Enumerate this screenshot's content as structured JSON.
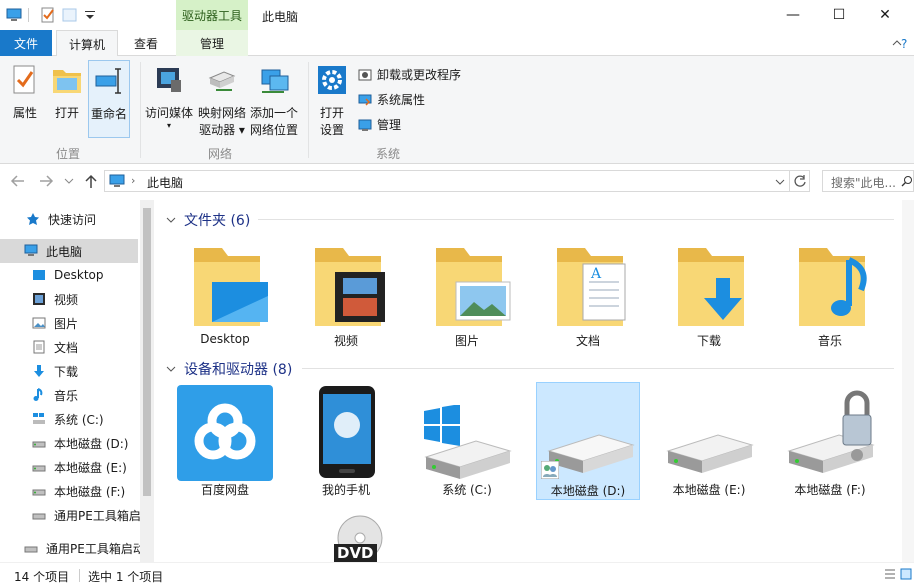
{
  "title_bar": {
    "context_tab": "驱动器工具",
    "title": "此电脑",
    "minimize": "—",
    "maximize": "☐",
    "close": "✕"
  },
  "tabs": {
    "file": "文件",
    "computer": "计算机",
    "view": "查看",
    "manage": "管理"
  },
  "ribbon": {
    "location": {
      "group": "位置",
      "properties": "属性",
      "open": "打开",
      "rename": "重命名"
    },
    "network": {
      "group": "网络",
      "access_media": "访问媒体",
      "map_drive_1": "映射网络",
      "map_drive_2": "驱动器",
      "add_location_1": "添加一个",
      "add_location_2": "网络位置"
    },
    "system": {
      "group": "系统",
      "open_settings_1": "打开",
      "open_settings_2": "设置",
      "uninstall": "卸载或更改程序",
      "system_properties": "系统属性",
      "manage": "管理"
    }
  },
  "address": {
    "path": "此电脑",
    "search_placeholder": "搜索\"此电..."
  },
  "nav": {
    "quick_access": "快速访问",
    "this_pc": "此电脑",
    "desktop": "Desktop",
    "videos": "视频",
    "pictures": "图片",
    "documents": "文档",
    "downloads": "下载",
    "music": "音乐",
    "system_c": "系统 (C:)",
    "local_d": "本地磁盘 (D:)",
    "local_e": "本地磁盘 (E:)",
    "local_f": "本地磁盘 (F:)",
    "pe_1": "通用PE工具箱启",
    "pe_2": "通用PE工具箱启动"
  },
  "folders": {
    "header": "文件夹 (6)",
    "items": [
      "Desktop",
      "视频",
      "图片",
      "文档",
      "下载",
      "音乐"
    ]
  },
  "drives": {
    "header": "设备和驱动器 (8)",
    "items": [
      "百度网盘",
      "我的手机",
      "系统 (C:)",
      "本地磁盘 (D:)",
      "本地磁盘 (E:)",
      "本地磁盘 (F:)"
    ],
    "dvd": "DVD"
  },
  "status": {
    "count": "14 个项目",
    "selected": "选中 1 个项目"
  },
  "colors": {
    "accent": "#1979ca",
    "selection": "#cce8ff",
    "folder": "#f8d775",
    "header_text": "#1e3287"
  }
}
